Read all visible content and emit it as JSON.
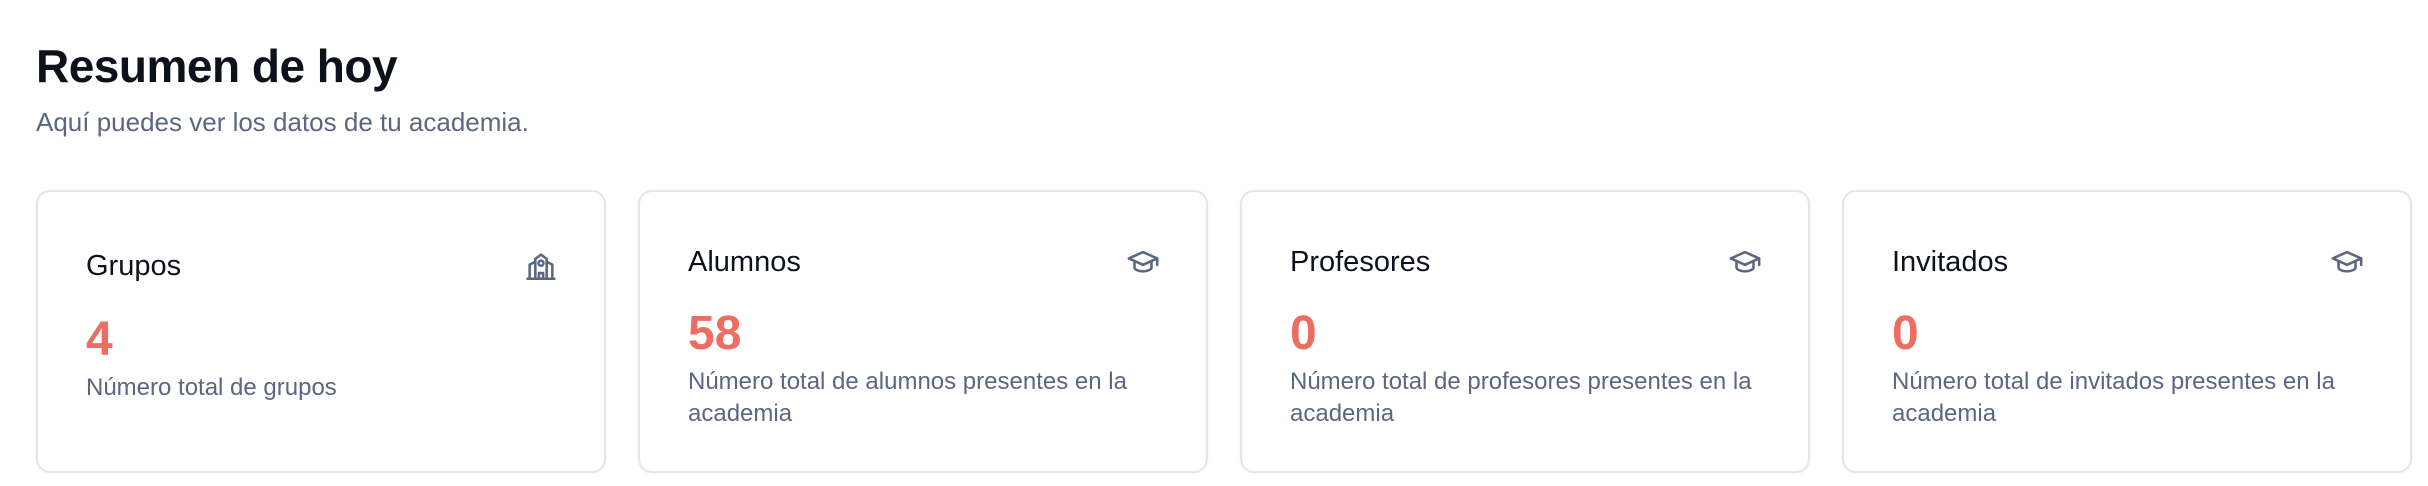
{
  "header": {
    "title": "Resumen de hoy",
    "subtitle": "Aquí puedes ver los datos de tu academia."
  },
  "colors": {
    "accent": "#ee6d62",
    "muted_text": "#5b6780",
    "border": "#e3e6eb"
  },
  "cards": [
    {
      "label": "Grupos",
      "value": "4",
      "description": "Número total de grupos",
      "icon": "school-building-icon"
    },
    {
      "label": "Alumnos",
      "value": "58",
      "description": "Número total de alumnos presentes en la academia",
      "icon": "graduation-cap-icon"
    },
    {
      "label": "Profesores",
      "value": "0",
      "description": "Número total de profesores presentes en la academia",
      "icon": "graduation-cap-icon"
    },
    {
      "label": "Invitados",
      "value": "0",
      "description": "Número total de invitados presentes en la academia",
      "icon": "graduation-cap-icon"
    }
  ]
}
